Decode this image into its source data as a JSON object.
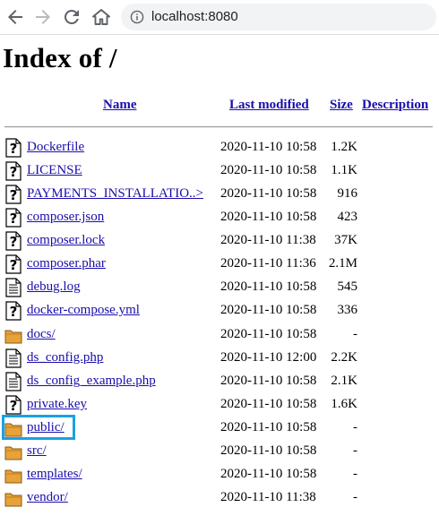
{
  "browser": {
    "url": "localhost:8080"
  },
  "page": {
    "title": "Index of /",
    "headers": {
      "name": "Name",
      "last_modified": "Last modified",
      "size": "Size",
      "description": "Description"
    },
    "entries": [
      {
        "name": "Dockerfile",
        "modified": "2020-11-10 10:58",
        "size": "1.2K",
        "icon": "unknown-file-icon"
      },
      {
        "name": "LICENSE",
        "modified": "2020-11-10 10:58",
        "size": "1.1K",
        "icon": "unknown-file-icon"
      },
      {
        "name": "PAYMENTS_INSTALLATIO..>",
        "modified": "2020-11-10 10:58",
        "size": "916",
        "icon": "unknown-file-icon"
      },
      {
        "name": "composer.json",
        "modified": "2020-11-10 10:58",
        "size": "423",
        "icon": "unknown-file-icon"
      },
      {
        "name": "composer.lock",
        "modified": "2020-11-10 11:38",
        "size": "37K",
        "icon": "unknown-file-icon"
      },
      {
        "name": "composer.phar",
        "modified": "2020-11-10 11:36",
        "size": "2.1M",
        "icon": "unknown-file-icon"
      },
      {
        "name": "debug.log",
        "modified": "2020-11-10 10:58",
        "size": "545",
        "icon": "text-file-icon"
      },
      {
        "name": "docker-compose.yml",
        "modified": "2020-11-10 10:58",
        "size": "336",
        "icon": "unknown-file-icon"
      },
      {
        "name": "docs/",
        "modified": "2020-11-10 10:58",
        "size": "-",
        "icon": "folder-icon"
      },
      {
        "name": "ds_config.php",
        "modified": "2020-11-10 12:00",
        "size": "2.2K",
        "icon": "text-file-icon"
      },
      {
        "name": "ds_config_example.php",
        "modified": "2020-11-10 10:58",
        "size": "2.1K",
        "icon": "text-file-icon"
      },
      {
        "name": "private.key",
        "modified": "2020-11-10 10:58",
        "size": "1.6K",
        "icon": "unknown-file-icon"
      },
      {
        "name": "public/",
        "modified": "2020-11-10 10:58",
        "size": "-",
        "icon": "folder-icon"
      },
      {
        "name": "src/",
        "modified": "2020-11-10 10:58",
        "size": "-",
        "icon": "folder-icon"
      },
      {
        "name": "templates/",
        "modified": "2020-11-10 10:58",
        "size": "-",
        "icon": "folder-icon"
      },
      {
        "name": "vendor/",
        "modified": "2020-11-10 11:38",
        "size": "-",
        "icon": "folder-icon"
      }
    ]
  },
  "colors": {
    "link": "#1a0dab",
    "highlight": "#1ba1e2",
    "folder": "#e8a23a"
  }
}
